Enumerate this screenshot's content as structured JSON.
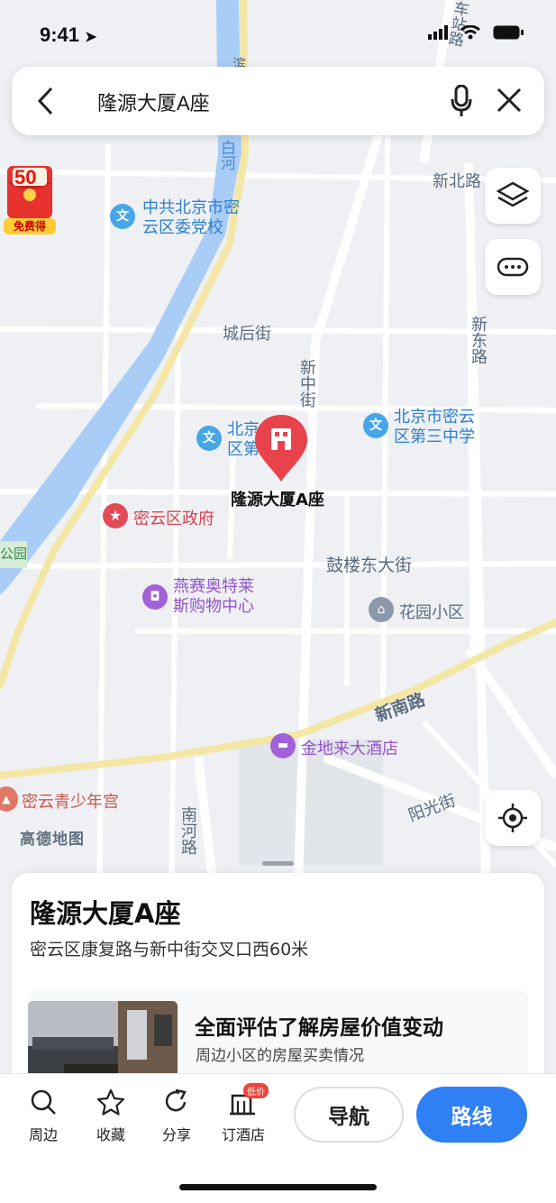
{
  "status_bar": {
    "time": "9:41"
  },
  "search": {
    "query": "隆源大厦A座"
  },
  "promo": {
    "amount": "50",
    "tag": "免费得"
  },
  "map": {
    "pin_label": "隆源大厦A座",
    "watermark": "高德地图",
    "roads": [
      {
        "id": "r1",
        "text": "新北路"
      },
      {
        "id": "r2",
        "text": "城后街"
      },
      {
        "id": "r3",
        "text": "新中街"
      },
      {
        "id": "r4",
        "text": "新东路"
      },
      {
        "id": "r5",
        "text": "鼓楼东大街"
      },
      {
        "id": "r6",
        "text": "新南路"
      },
      {
        "id": "r7",
        "text": "南河路"
      },
      {
        "id": "r8",
        "text": "阳光街"
      },
      {
        "id": "r9",
        "text": "白河"
      },
      {
        "id": "r10",
        "text": "公园"
      },
      {
        "id": "r11",
        "text": "车站路"
      },
      {
        "id": "r12",
        "text": "滨"
      }
    ],
    "pois": [
      {
        "id": "p1",
        "line1": "中共北京市密",
        "line2": "云区委党校",
        "icon": "school-icon"
      },
      {
        "id": "p2",
        "line1": "北京市密云",
        "line2": "区第三中学",
        "icon": "school-icon"
      },
      {
        "id": "p3",
        "line1": "北京",
        "line2": "区第",
        "icon": "school-icon"
      },
      {
        "id": "p4",
        "line1": "密云区政府",
        "line2": "",
        "icon": "government-icon"
      },
      {
        "id": "p5",
        "line1": "燕赛奥特莱",
        "line2": "斯购物中心",
        "icon": "shopping-icon"
      },
      {
        "id": "p6",
        "line1": "花园小区",
        "line2": "",
        "icon": "residential-icon"
      },
      {
        "id": "p7",
        "line1": "金地来大酒店",
        "line2": "",
        "icon": "hotel-icon"
      },
      {
        "id": "p8",
        "line1": "密云青少年宫",
        "line2": "",
        "icon": "landmark-icon"
      }
    ]
  },
  "card": {
    "title": "隆源大厦A座",
    "address": "密云区康复路与新中街交叉口西60米",
    "promo_title": "全面评估了解房屋价值变动",
    "promo_sub": "周边小区的房屋买卖情况"
  },
  "toolbar": {
    "items": [
      {
        "label": "周边",
        "icon": "search-icon"
      },
      {
        "label": "收藏",
        "icon": "star-icon"
      },
      {
        "label": "分享",
        "icon": "share-icon"
      },
      {
        "label": "订酒店",
        "icon": "hotel-icon",
        "badge": "低价"
      }
    ],
    "nav_label": "导航",
    "route_label": "路线"
  },
  "colors": {
    "accent": "#2f7ff5",
    "pin": "#e8434c",
    "river": "#a9cdf7",
    "main_road": "#f4e6a4"
  }
}
